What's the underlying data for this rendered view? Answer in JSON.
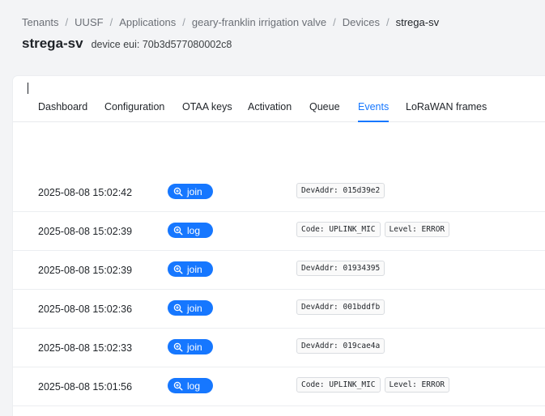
{
  "breadcrumb": {
    "items": [
      "Tenants",
      "UUSF",
      "Applications",
      "geary-franklin irrigation valve",
      "Devices",
      "strega-sv"
    ],
    "separator": "/"
  },
  "header": {
    "title": "strega-sv",
    "device_eui": "device eui: 70b3d577080002c8"
  },
  "tabs": [
    {
      "label": "Dashboard",
      "active": false
    },
    {
      "label": "Configuration",
      "active": false
    },
    {
      "label": "OTAA keys",
      "active": false
    },
    {
      "label": "Activation",
      "active": false
    },
    {
      "label": "Queue",
      "active": false
    },
    {
      "label": "Events",
      "active": true
    },
    {
      "label": "LoRaWAN frames",
      "active": false
    }
  ],
  "events": [
    {
      "timestamp": "2025-08-08 15:02:42",
      "type": "join",
      "tags": [
        "DevAddr: 015d39e2"
      ]
    },
    {
      "timestamp": "2025-08-08 15:02:39",
      "type": "log",
      "tags": [
        "Code: UPLINK_MIC",
        "Level: ERROR"
      ]
    },
    {
      "timestamp": "2025-08-08 15:02:39",
      "type": "join",
      "tags": [
        "DevAddr: 01934395"
      ]
    },
    {
      "timestamp": "2025-08-08 15:02:36",
      "type": "join",
      "tags": [
        "DevAddr: 001bddfb"
      ]
    },
    {
      "timestamp": "2025-08-08 15:02:33",
      "type": "join",
      "tags": [
        "DevAddr: 019cae4a"
      ]
    },
    {
      "timestamp": "2025-08-08 15:01:56",
      "type": "log",
      "tags": [
        "Code: UPLINK_MIC",
        "Level: ERROR"
      ]
    }
  ],
  "colors": {
    "accent": "#1677ff",
    "background": "#f3f4f6",
    "card": "#ffffff"
  },
  "icons": {
    "event_button": "zoom-in-icon"
  }
}
